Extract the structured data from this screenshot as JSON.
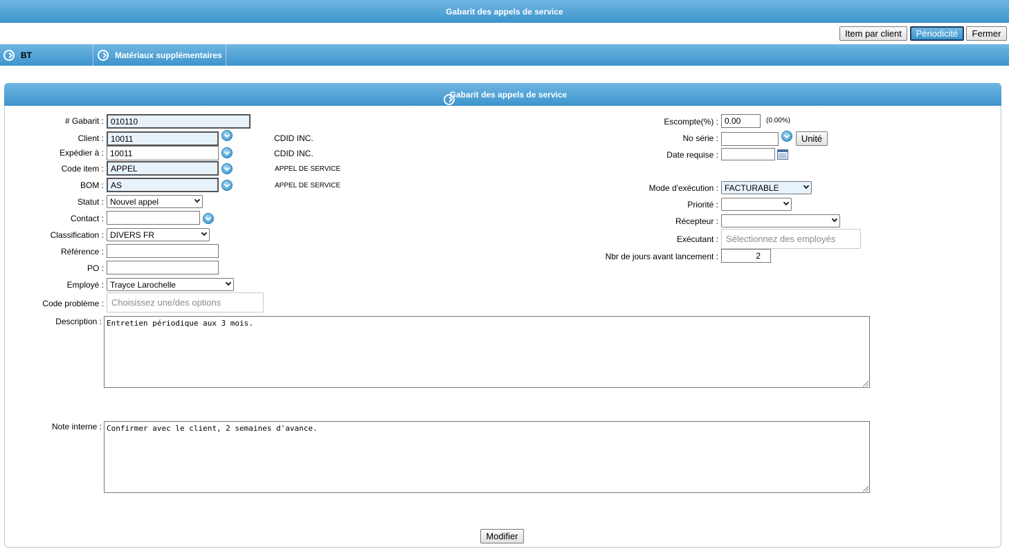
{
  "header": {
    "title": "Gabarit des appels de service"
  },
  "toolbar": {
    "item_par_client": "Item par client",
    "periodicite": "Périodicité",
    "fermer": "Fermer"
  },
  "tabs": [
    {
      "label": "BT"
    },
    {
      "label": "Matériaux supplémentaires"
    }
  ],
  "panel": {
    "title": "Gabarit des appels de service"
  },
  "form_left": {
    "gabarit": {
      "label": "# Gabarit :",
      "value": "010110"
    },
    "client": {
      "label": "Client :",
      "value": "10011",
      "name": "CDID INC."
    },
    "expedier": {
      "label": "Expédier à :",
      "value": "10011",
      "name": "CDID INC."
    },
    "code_item": {
      "label": "Code item :",
      "value": "APPEL",
      "desc": "APPEL DE SERVICE"
    },
    "bom": {
      "label": "BOM :",
      "value": "AS",
      "desc": "APPEL DE SERVICE"
    },
    "statut": {
      "label": "Statut :",
      "value": "Nouvel appel"
    },
    "contact": {
      "label": "Contact :",
      "value": ""
    },
    "classification": {
      "label": "Classification :",
      "value": "DIVERS FR"
    },
    "reference": {
      "label": "Référence :",
      "value": ""
    },
    "po": {
      "label": "PO :",
      "value": ""
    },
    "employe": {
      "label": "Employé :",
      "value": "Trayce Larochelle"
    },
    "code_probleme": {
      "label": "Code problème :",
      "placeholder": "Choisissez une/des options"
    },
    "description": {
      "label": "Description :",
      "value": "Entretien périodique aux 3 mois."
    },
    "note_interne": {
      "label": "Note interne :",
      "value": "Confirmer avec le client, 2 semaines d'avance."
    }
  },
  "form_right": {
    "escompte": {
      "label": "Escompte(%) :",
      "value": "0.00",
      "note": "(0.00%)"
    },
    "no_serie": {
      "label": "No série :",
      "value": "",
      "button": "Unité"
    },
    "date_requise": {
      "label": "Date requise :",
      "value": ""
    },
    "mode_execution": {
      "label": "Mode d'exécution :",
      "value": "FACTURABLE"
    },
    "priorite": {
      "label": "Priorité :",
      "value": ""
    },
    "recepteur": {
      "label": "Récepteur :",
      "value": ""
    },
    "executant": {
      "label": "Exécutant :",
      "placeholder": "Sélectionnez des employés"
    },
    "nbr_jours": {
      "label": "Nbr de jours avant lancement :",
      "value": "2"
    }
  },
  "footer": {
    "modifier": "Modifier"
  }
}
